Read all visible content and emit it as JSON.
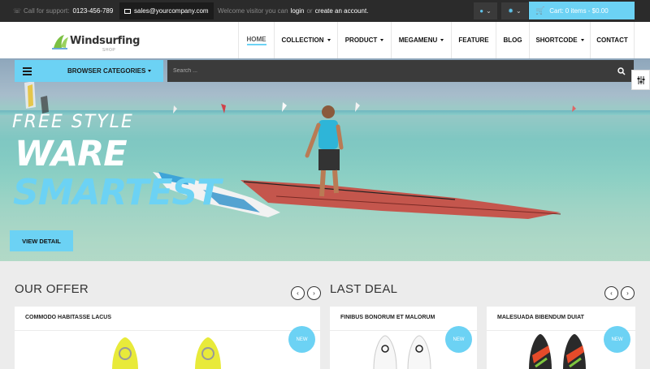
{
  "topbar": {
    "support_label": "Call for support:",
    "support_phone": "0123-456-789",
    "email": "sales@yourcompany.com",
    "welcome_text": "Welcome visitor you can",
    "login_label": "login",
    "or_text": "or",
    "create_account_label": "create an account.",
    "user_icon": "user-icon",
    "settings_icon": "gear-icon",
    "cart_label": "Cart: 0 items - $0.00"
  },
  "header": {
    "brand": "Windsurfing",
    "brand_sub": "SHOP",
    "nav": [
      {
        "label": "HOME",
        "dropdown": false,
        "active": true
      },
      {
        "label": "COLLECTION",
        "dropdown": true
      },
      {
        "label": "PRODUCT",
        "dropdown": true
      },
      {
        "label": "MEGAMENU",
        "dropdown": true
      },
      {
        "label": "FEATURE",
        "dropdown": false
      },
      {
        "label": "BLOG",
        "dropdown": false
      },
      {
        "label": "SHORTCODE",
        "dropdown": true
      },
      {
        "label": "CONTACT",
        "dropdown": false
      }
    ]
  },
  "categories": {
    "label": "BROWSER CATEGORIES"
  },
  "search": {
    "placeholder": "Search ..."
  },
  "hero": {
    "line1": "FREE STYLE",
    "line2": "WARE",
    "line3": "SMARTEST",
    "button": "VIEW DETAIL"
  },
  "offer": {
    "title": "OUR OFFER",
    "products": [
      {
        "name": "COMMODO HABITASSE LACUS",
        "badge": "NEW"
      }
    ]
  },
  "deal": {
    "title": "LAST DEAL",
    "products": [
      {
        "name": "FINIBUS BONORUM ET MALORUM",
        "badge": "NEW"
      },
      {
        "name": "MALESUADA BIBENDUM DUIAT",
        "badge": "NEW"
      }
    ]
  },
  "colors": {
    "accent": "#6cd2f4",
    "dark": "#2b2b2b"
  }
}
